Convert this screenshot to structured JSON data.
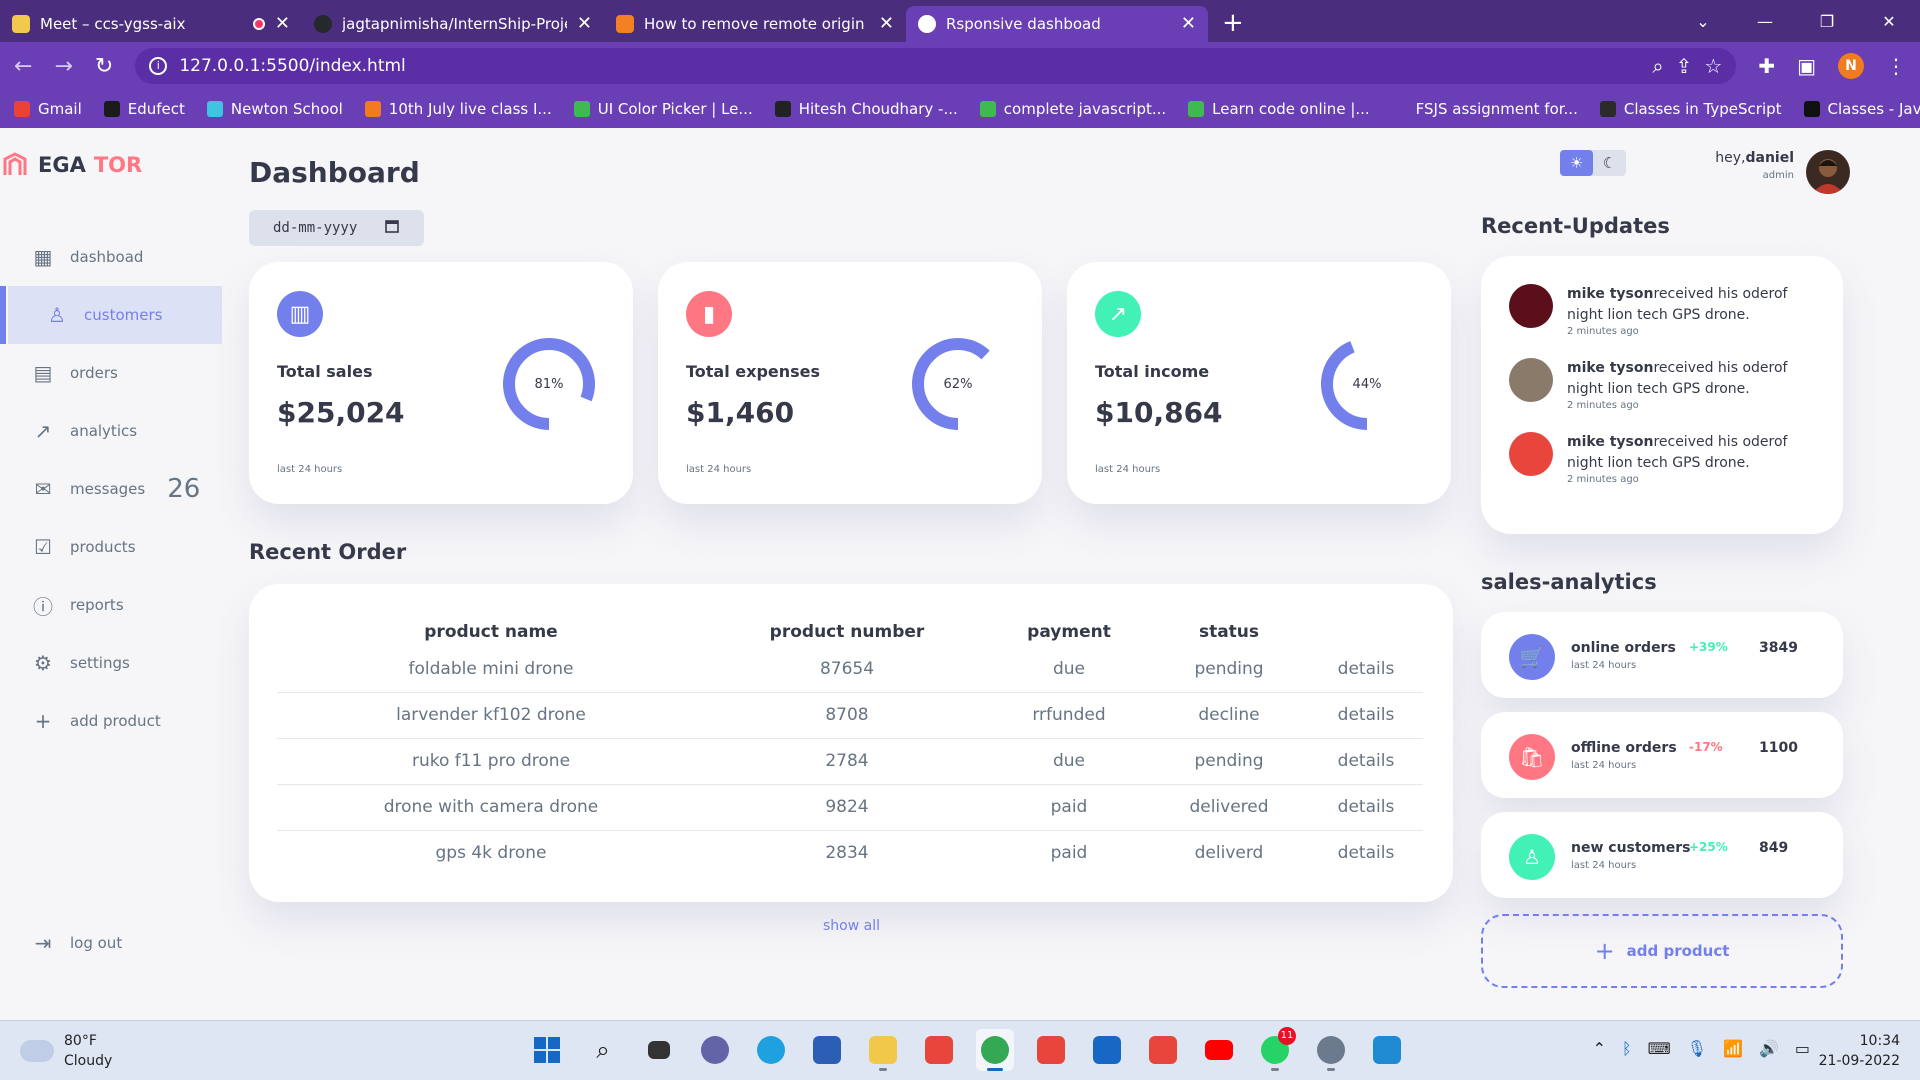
{
  "browser": {
    "tabs": [
      {
        "title": "Meet – ccs-ygss-aix",
        "color": "#f2c94c",
        "recording": true
      },
      {
        "title": "jagtapnimisha/InternShip-Project",
        "color": "#24292e"
      },
      {
        "title": "How to remove remote origin fro",
        "color": "#f48024"
      },
      {
        "title": "Rsponsive dashboad",
        "color": "#ffffff",
        "active": true
      }
    ],
    "url": "127.0.0.1:5500/index.html",
    "profile_initial": "N",
    "bookmarks": [
      {
        "label": "Gmail",
        "color": "#ea4335"
      },
      {
        "label": "Edufect",
        "color": "#1b1b1b"
      },
      {
        "label": "Newton School",
        "color": "#3ec3e0"
      },
      {
        "label": "10th July live class I...",
        "color": "#f07c1f"
      },
      {
        "label": "UI Color Picker | Le...",
        "color": "#3fb950"
      },
      {
        "label": "Hitesh Choudhary -...",
        "color": "#222222"
      },
      {
        "label": "complete javascript...",
        "color": "#3fb950"
      },
      {
        "label": "Learn code online |...",
        "color": "#3fb950"
      },
      {
        "label": "FSJS assignment for...",
        "color": "#6a3fb5"
      },
      {
        "label": "Classes in TypeScript",
        "color": "#2b2b2b"
      },
      {
        "label": "Classes - JavaScript...",
        "color": "#111111"
      }
    ],
    "bookmarks_more": "»"
  },
  "app": {
    "logo_part1": "EGA",
    "logo_part2": "TOR",
    "sidebar": [
      {
        "label": "dashboad",
        "icon": "grid-icon"
      },
      {
        "label": "customers",
        "icon": "person-icon",
        "active": true
      },
      {
        "label": "orders",
        "icon": "receipt-icon"
      },
      {
        "label": "analytics",
        "icon": "chart-icon"
      },
      {
        "label": "messages",
        "icon": "mail-icon",
        "count": "26"
      },
      {
        "label": "products",
        "icon": "clipboard-icon"
      },
      {
        "label": "reports",
        "icon": "alert-icon"
      },
      {
        "label": "settings",
        "icon": "gear-icon"
      },
      {
        "label": "add product",
        "icon": "plus-icon"
      }
    ],
    "logout": "log out",
    "title": "Dashboard",
    "date_placeholder": "dd-mm-yyyy",
    "cards": [
      {
        "title": "Total sales",
        "value": "$25,024",
        "percent": 81,
        "percent_label": "81%",
        "footer": "last 24 hours",
        "color": "#7380ec",
        "icon": "analytics-icon"
      },
      {
        "title": "Total expenses",
        "value": "$1,460",
        "percent": 62,
        "percent_label": "62%",
        "footer": "last 24 hours",
        "color": "#ff7782",
        "icon": "bar-chart-icon"
      },
      {
        "title": "Total income",
        "value": "$10,864",
        "percent": 44,
        "percent_label": "44%",
        "footer": "last 24 hours",
        "color": "#41f1b6",
        "icon": "stocks-icon"
      }
    ],
    "recent_order_title": "Recent Order",
    "orders_headers": [
      "product name",
      "product number",
      "payment",
      "status"
    ],
    "orders": [
      {
        "name": "foldable mini drone",
        "number": "87654",
        "payment": "due",
        "status": "pending",
        "status_class": "st-pending",
        "action": "details"
      },
      {
        "name": "larvender kf102 drone",
        "number": "8708",
        "payment": "rrfunded",
        "status": "decline",
        "status_class": "st-decline",
        "action": "details"
      },
      {
        "name": "ruko f11 pro drone",
        "number": "2784",
        "payment": "due",
        "status": "pending",
        "status_class": "st-pending",
        "action": "details"
      },
      {
        "name": "drone with camera drone",
        "number": "9824",
        "payment": "paid",
        "status": "delivered",
        "status_class": "st-delivered",
        "action": "details"
      },
      {
        "name": "gps 4k drone",
        "number": "2834",
        "payment": "paid",
        "status": "deliverd",
        "status_class": "st-delivered",
        "action": "details"
      }
    ],
    "show_all": "show all",
    "greeting": "hey,",
    "user_name": "daniel",
    "user_role": "admin",
    "recent_updates_title": "Recent-Updates",
    "updates": [
      {
        "name": "mike tyson",
        "text": "received his oderof night lion tech GPS drone.",
        "time": "2 minutes ago",
        "avatar_color": "#5a0f1a"
      },
      {
        "name": "mike tyson",
        "text": "received his oderof night lion tech GPS drone.",
        "time": "2 minutes ago",
        "avatar_color": "#8a7a6a"
      },
      {
        "name": "mike tyson",
        "text": "received his oderof night lion tech GPS drone.",
        "time": "2 minutes ago",
        "avatar_color": "#e8453c"
      }
    ],
    "sales_analytics_title": "sales-analytics",
    "analytics": [
      {
        "name": "online orders",
        "sub": "last 24 hours",
        "pct": "+39%",
        "value": "3849",
        "color": "#7380ec",
        "pct_color": "#41f1b6",
        "icon": "cart-icon"
      },
      {
        "name": "offline orders",
        "sub": "last 24 hours",
        "pct": "-17%",
        "value": "1100",
        "color": "#ff7782",
        "pct_color": "#ff7782",
        "icon": "bag-icon"
      },
      {
        "name": "new customers",
        "sub": "last 24 hours",
        "pct": "+25%",
        "value": "849",
        "color": "#41f1b6",
        "pct_color": "#41f1b6",
        "icon": "person-icon"
      }
    ],
    "add_product": "add product"
  },
  "taskbar": {
    "temp": "80°F",
    "condition": "Cloudy",
    "time": "10:34",
    "date": "21-09-2022",
    "whatsapp_badge": "11"
  }
}
